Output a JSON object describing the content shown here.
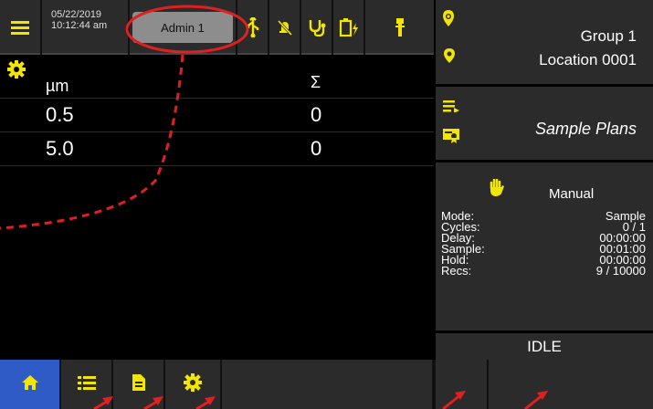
{
  "status_bar": {
    "date": "05/22/2019",
    "time": "10:12:44 am",
    "user": "Admin 1",
    "icons": [
      "menu-icon",
      "usb-icon",
      "alarm-off-icon",
      "stethoscope-icon",
      "battery-charging-icon",
      "probe-icon"
    ]
  },
  "table": {
    "col1_header": "µm",
    "col2_header": "Σ",
    "rows": [
      {
        "size": "0.5",
        "count": "0"
      },
      {
        "size": "5.0",
        "count": "0"
      }
    ]
  },
  "location": {
    "group": "Group 1",
    "location": "Location 0001"
  },
  "plans": {
    "label": "Sample Plans"
  },
  "status": {
    "mode_name": "Manual",
    "rows": [
      {
        "key": "Mode:",
        "value": "Sample"
      },
      {
        "key": "Cycles:",
        "value": "0 / 1"
      },
      {
        "key": "Delay:",
        "value": "00:00:00"
      },
      {
        "key": "Sample:",
        "value": "00:01:00"
      },
      {
        "key": "Hold:",
        "value": "00:00:00"
      },
      {
        "key": "Recs:",
        "value": "9 / 10000"
      }
    ],
    "state": "IDLE"
  },
  "colors": {
    "accent_yellow": "#f2e600",
    "nav_active": "#2f5bc7",
    "panel_gray": "#2b2b2b",
    "annotation_red": "#e02020"
  }
}
